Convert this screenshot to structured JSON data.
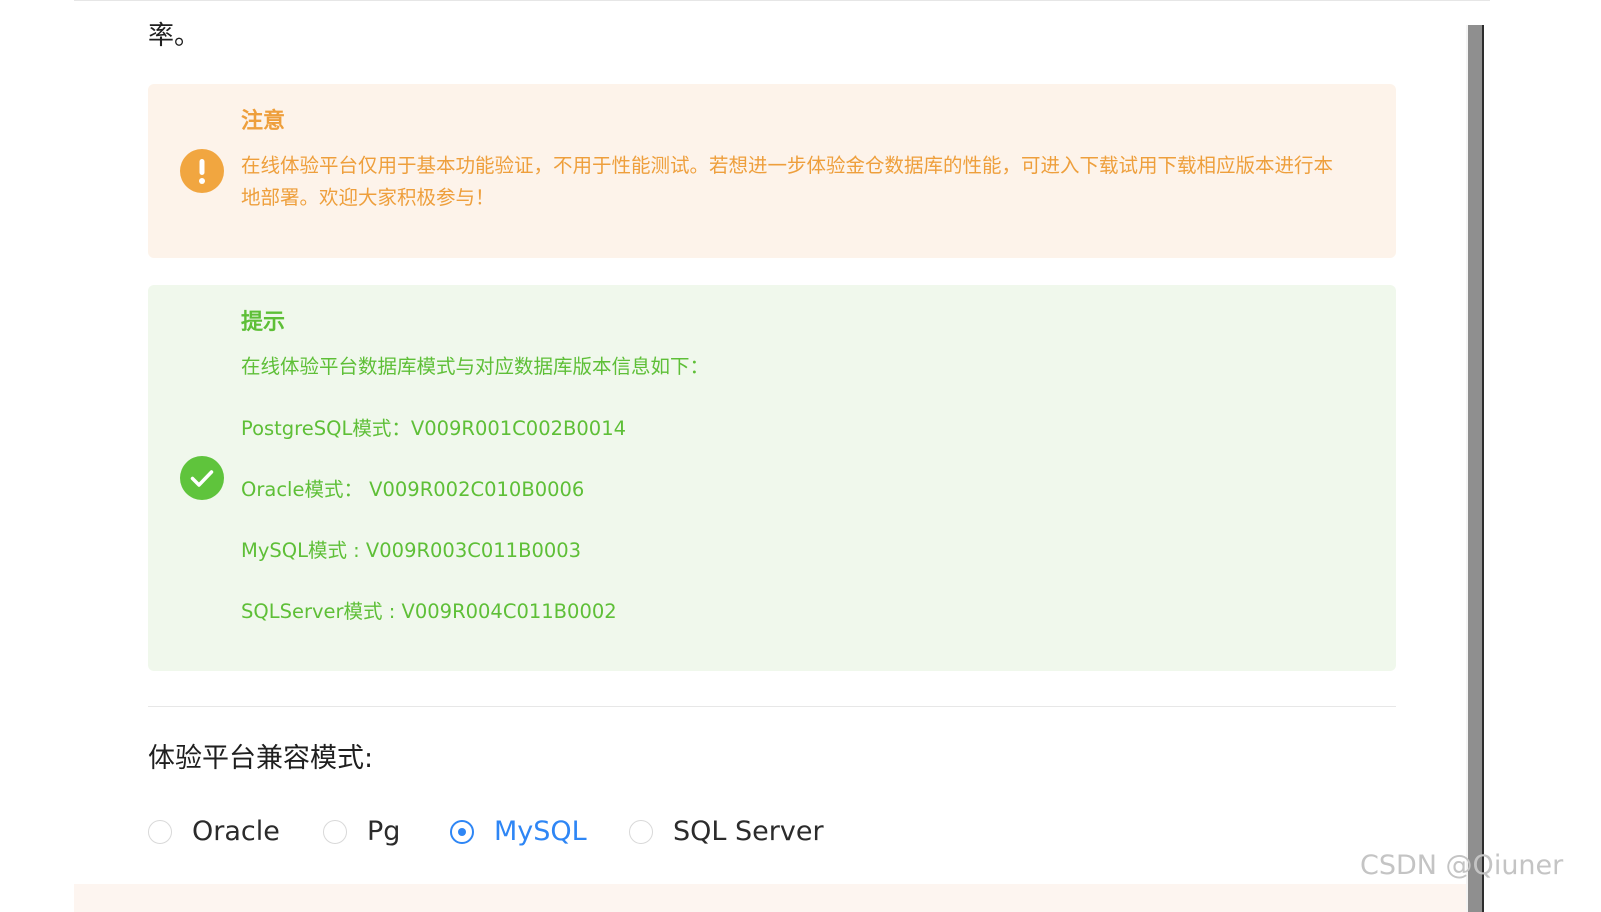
{
  "page": {
    "fragment_text": "率。"
  },
  "warning_alert": {
    "title": "注意",
    "body": "在线体验平台仅用于基本功能验证，不用于性能测试。若想进一步体验金仓数据库的性能，可进入下载试用下载相应版本进行本地部署。欢迎大家积极参与！",
    "icon": "exclamation-circle-icon",
    "color": "#ee9f3c",
    "background": "#fdf3ea"
  },
  "success_alert": {
    "title": "提示",
    "intro": "在线体验平台数据库模式与对应数据库版本信息如下：",
    "versions": [
      "PostgreSQL模式：V009R001C002B0014",
      "Oracle模式： V009R002C010B0006",
      "MySQL模式 : V009R003C011B0003",
      "SQLServer模式 : V009R004C011B0002"
    ],
    "icon": "check-circle-icon",
    "color": "#5ebf37",
    "background": "#f0f8ec"
  },
  "compat_mode": {
    "title": "体验平台兼容模式:",
    "options": [
      {
        "label": "Oracle",
        "selected": false
      },
      {
        "label": "Pg",
        "selected": false
      },
      {
        "label": "MySQL",
        "selected": true
      },
      {
        "label": "SQL Server",
        "selected": false
      }
    ],
    "selected_value": "MySQL",
    "accent_color": "#2e86f5"
  },
  "watermark": {
    "text": "CSDN @Qiuner"
  }
}
